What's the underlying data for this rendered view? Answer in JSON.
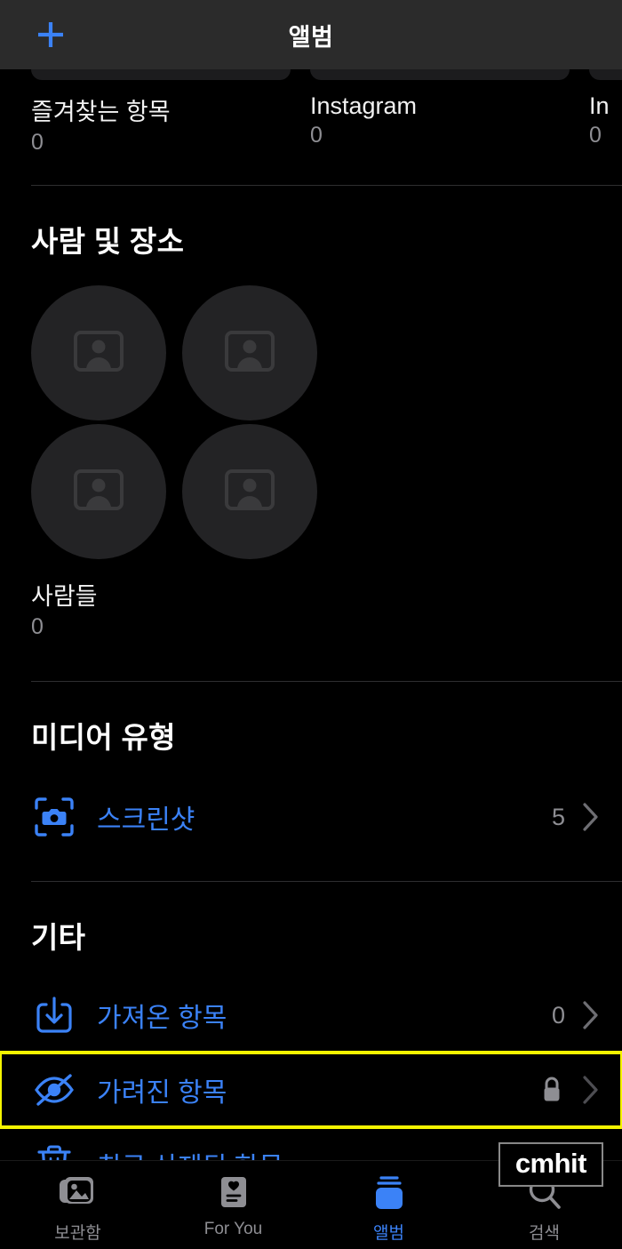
{
  "navbar": {
    "title": "앨범",
    "add_label": "+",
    "add_icon": "plus-icon",
    "accent_color": "#3b82f7",
    "background_color": "#2b2b2b"
  },
  "albums_row": {
    "items": [
      {
        "name": "즐겨찾는 항목",
        "count": "0"
      },
      {
        "name": "Instagram",
        "count": "0"
      },
      {
        "name": "In",
        "count": "0"
      }
    ]
  },
  "people_places": {
    "title": "사람 및 장소",
    "avatar_icon": "person-photo-placeholder-icon",
    "avatar_count": 4,
    "label": "사람들",
    "count": "0"
  },
  "media_types": {
    "title": "미디어 유형",
    "rows": [
      {
        "icon": "screenshot-camera-icon",
        "label": "스크린샷",
        "count": "5",
        "locked": false,
        "chevron": true
      }
    ]
  },
  "other": {
    "title": "기타",
    "rows": [
      {
        "icon": "import-download-icon",
        "label": "가져온 항목",
        "count": "0",
        "locked": false,
        "chevron": true,
        "highlighted": false
      },
      {
        "icon": "eye-slash-icon",
        "label": "가려진 항목",
        "count": "",
        "locked": true,
        "chevron": true,
        "highlighted": true,
        "highlight_color": "#f5f500"
      },
      {
        "icon": "trash-icon",
        "label": "최근 삭제된 항목",
        "count": "",
        "locked": true,
        "chevron": true,
        "highlighted": false
      }
    ]
  },
  "overlay_badge": {
    "text": "cmhit"
  },
  "tabbar": {
    "items": [
      {
        "label": "보관함",
        "icon": "photo-stack-icon",
        "active": false
      },
      {
        "label": "For You",
        "icon": "for-you-card-icon",
        "active": false
      },
      {
        "label": "앨범",
        "icon": "albums-stack-icon",
        "active": true
      },
      {
        "label": "검색",
        "icon": "search-magnifier-icon",
        "active": false
      }
    ],
    "active_color": "#3b82f7",
    "inactive_color": "#8e8e93"
  }
}
